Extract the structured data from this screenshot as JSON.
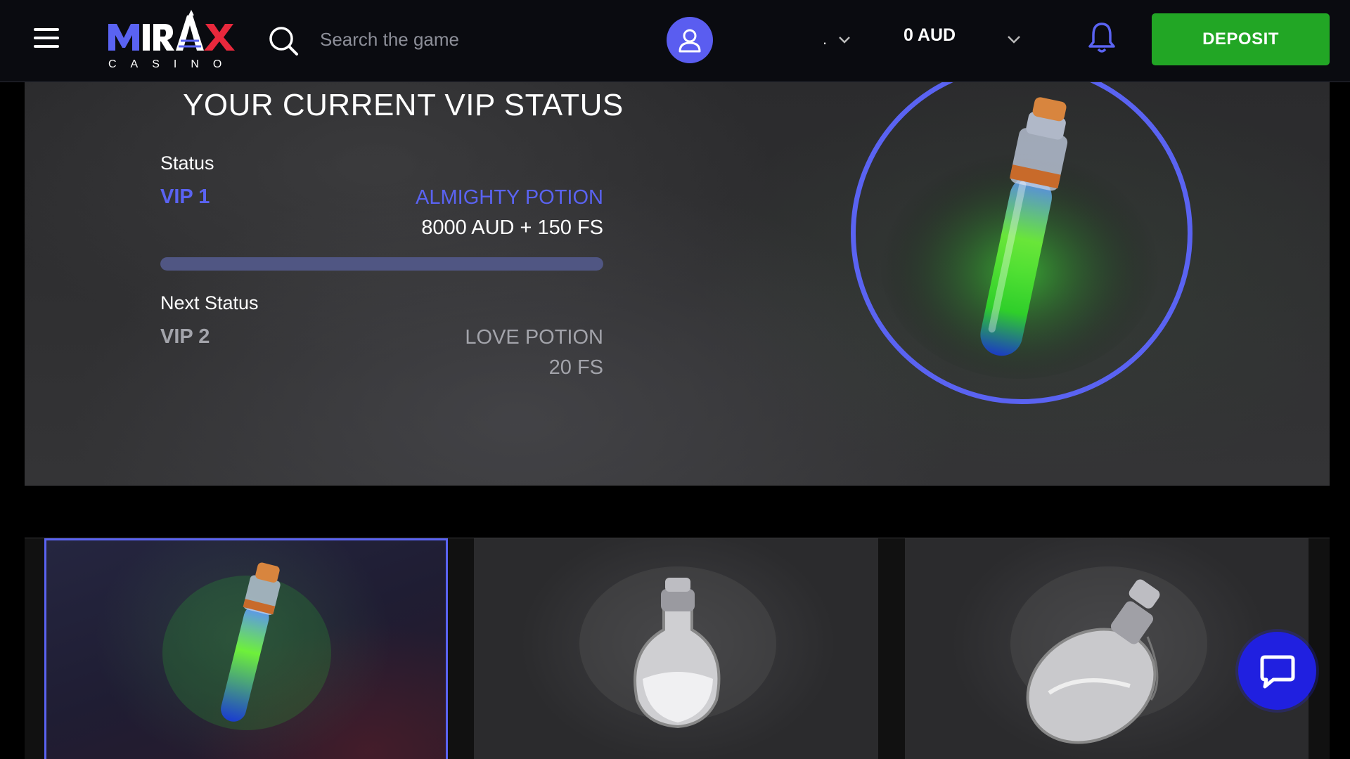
{
  "header": {
    "logo_text": "MIRAX",
    "logo_subtext": "CASINO",
    "search_placeholder": "Search the game",
    "language_value": ".",
    "balance": "0 AUD",
    "deposit_label": "DEPOSIT"
  },
  "vip": {
    "title": "YOUR CURRENT VIP STATUS",
    "current": {
      "label": "Status",
      "level": "VIP 1",
      "reward_name": "ALMIGHTY POTION",
      "reward_value": "8000 AUD + 150 FS"
    },
    "progress_fraction": 1.0,
    "next": {
      "label": "Next Status",
      "level": "VIP 2",
      "reward_name": "LOVE POTION",
      "reward_value": "20 FS"
    }
  },
  "cards": [
    {
      "name": "almighty-potion",
      "selected": true,
      "icon": "tall-vial-green-icon"
    },
    {
      "name": "love-potion",
      "selected": false,
      "icon": "round-flask-icon"
    },
    {
      "name": "potion-3",
      "selected": false,
      "icon": "round-bottle-icon"
    }
  ],
  "colors": {
    "accent": "#5a63f2",
    "deposit": "#22a625",
    "chat": "#2020e0",
    "header_bg": "#0a0b10"
  }
}
